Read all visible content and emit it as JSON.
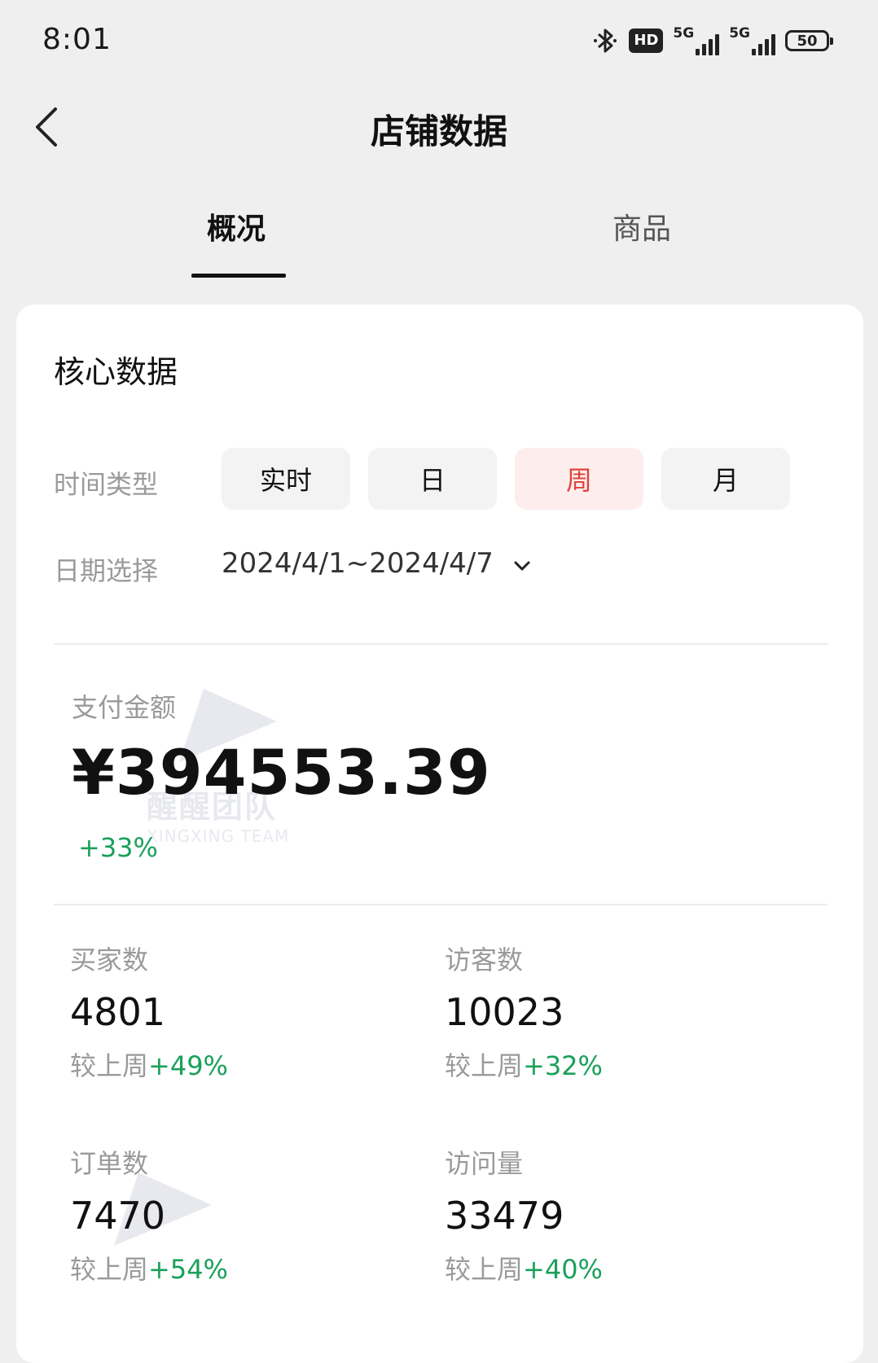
{
  "status_bar": {
    "time": "8:01",
    "hd_label": "HD",
    "network_1": "5G",
    "network_2": "5G",
    "battery": "50"
  },
  "header": {
    "title": "店铺数据"
  },
  "tabs": [
    {
      "label": "概况",
      "active": true
    },
    {
      "label": "商品",
      "active": false
    }
  ],
  "core": {
    "title": "核心数据",
    "time_type_label": "时间类型",
    "time_types": [
      "实时",
      "日",
      "周",
      "月"
    ],
    "selected_time_type": "周",
    "date_label": "日期选择",
    "date_range": "2024/4/1~2024/4/7"
  },
  "payment": {
    "label": "支付金额",
    "amount": "¥394553.39",
    "change": "+33%"
  },
  "metrics": {
    "buyers": {
      "label": "买家数",
      "value": "4801",
      "compare_text": "较上周",
      "compare_pct": "+49%"
    },
    "visitors": {
      "label": "访客数",
      "value": "10023",
      "compare_text": "较上周",
      "compare_pct": "+32%"
    },
    "orders": {
      "label": "订单数",
      "value": "7470",
      "compare_text": "较上周",
      "compare_pct": "+54%"
    },
    "visits": {
      "label": "访问量",
      "value": "33479",
      "compare_text": "较上周",
      "compare_pct": "+40%"
    }
  },
  "watermark": {
    "cn": "醒醒团队",
    "en": "XINGXING TEAM"
  },
  "colors": {
    "accent_red": "#e0423a",
    "positive_green": "#1aa05a"
  }
}
